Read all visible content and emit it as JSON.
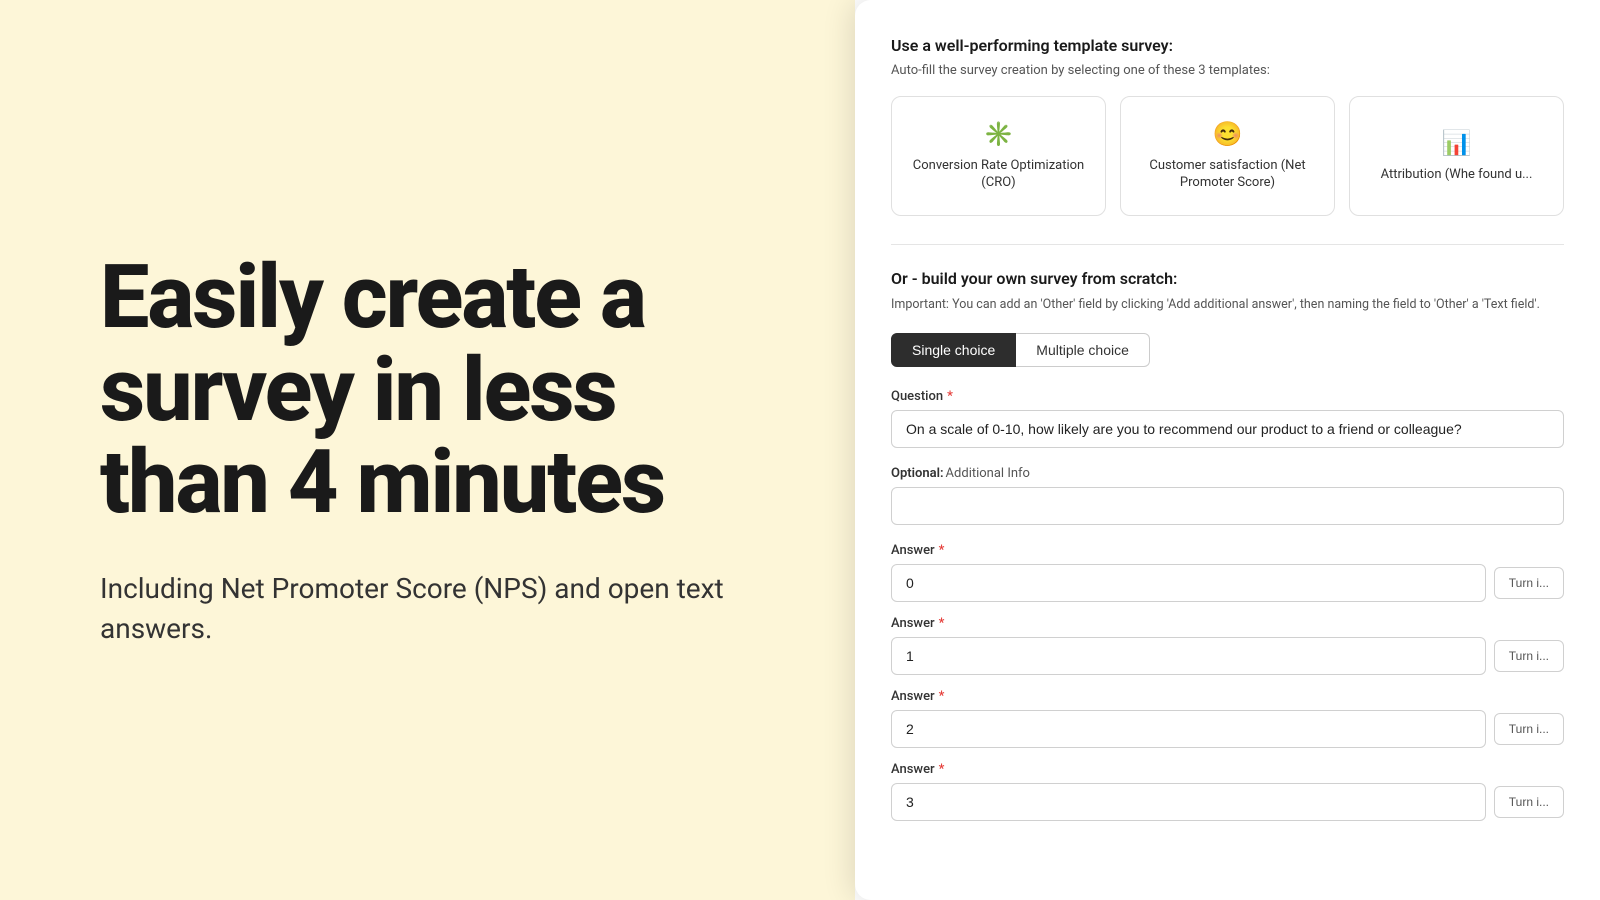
{
  "left": {
    "heading": "Easily create a survey in less than 4 minutes",
    "subheading": "Including Net Promoter Score (NPS) and open text answers."
  },
  "right": {
    "template_section": {
      "title": "Use a well-performing template survey:",
      "subtitle": "Auto-fill the survey creation by selecting one of these 3 templates:",
      "cards": [
        {
          "icon": "✳️",
          "label": "Conversion Rate Optimization (CRO)"
        },
        {
          "icon": "😊",
          "label": "Customer satisfaction (Net Promoter Score)"
        },
        {
          "icon": "📊",
          "label": "Attribution (Whe found u..."
        }
      ]
    },
    "scratch_section": {
      "title": "Or - build your own survey from scratch:",
      "note_label": "Important:",
      "note_text": "You can add an 'Other' field by clicking 'Add additional answer', then naming the field to 'Other' a 'Text field'.",
      "toggle": {
        "option1": "Single choice",
        "option2": "Multiple choice",
        "active": "option1"
      },
      "question_label": "Question",
      "question_placeholder": "On a scale of 0-10, how likely are you to recommend our product to a friend or colleague?",
      "optional_label": "Optional:",
      "optional_desc": "Additional Info",
      "optional_placeholder": "",
      "answers": [
        {
          "label": "Answer",
          "value": "0",
          "turn_in_label": "Turn i..."
        },
        {
          "label": "Answer",
          "value": "1",
          "turn_in_label": "Turn i..."
        },
        {
          "label": "Answer",
          "value": "2",
          "turn_in_label": "Turn i..."
        },
        {
          "label": "Answer",
          "value": "3",
          "turn_in_label": "Turn i..."
        }
      ]
    }
  }
}
